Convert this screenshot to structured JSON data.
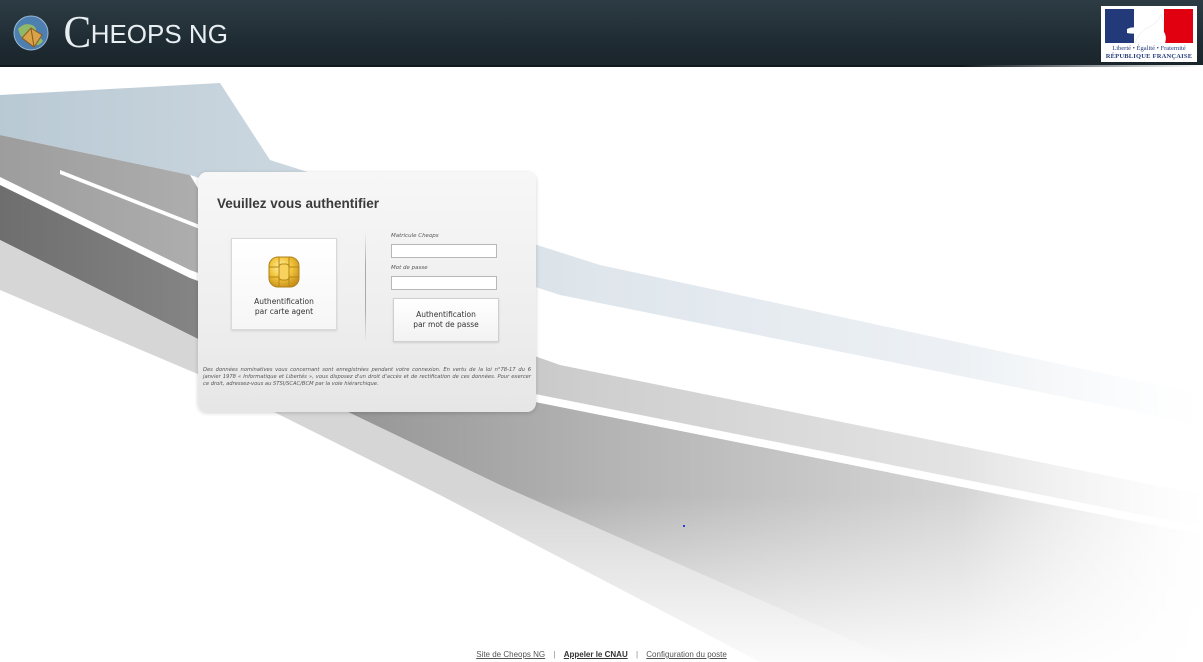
{
  "header": {
    "logo_initial": "C",
    "logo_rest": "HEOPS NG",
    "rf_motto": "Liberté • Égalité • Fraternité",
    "rf_name": "RÉPUBLIQUE FRANÇAISE"
  },
  "login": {
    "title": "Veuillez vous authentifier",
    "card_button": {
      "line1": "Authentification",
      "line2": "par carte agent"
    },
    "matricule_label": "Matricule Cheops",
    "matricule_value": "",
    "password_label": "Mot de passe",
    "password_value": "",
    "password_button": {
      "line1": "Authentification",
      "line2": "par mot de passe"
    },
    "legal_notice": "Des données nominatives vous concernant sont enregistrées pendant votre connexion. En vertu de la loi n°78-17 du 6 janvier 1978 « Informatique et Libertés », vous disposez d'un droit d'accès et de rectification de ces données. Pour exercer ce droit, adressez-vous au STSI/SCAC/BCM par la voie hiérarchique."
  },
  "footer": {
    "link1": "Site de Cheops NG",
    "link2": "Appeler le CNAU",
    "link3": "Configuration du poste",
    "separator": "|"
  },
  "colors": {
    "header_bg": "#1e2a31",
    "header_text": "#e8eef1",
    "chip_gold": "#f0c23a",
    "rf_blue": "#233a7a",
    "rf_red": "#e1000f"
  },
  "icons": {
    "globe": "globe-book-icon",
    "chip": "smart-card-chip-icon",
    "rf": "marianne-flag-logo"
  }
}
